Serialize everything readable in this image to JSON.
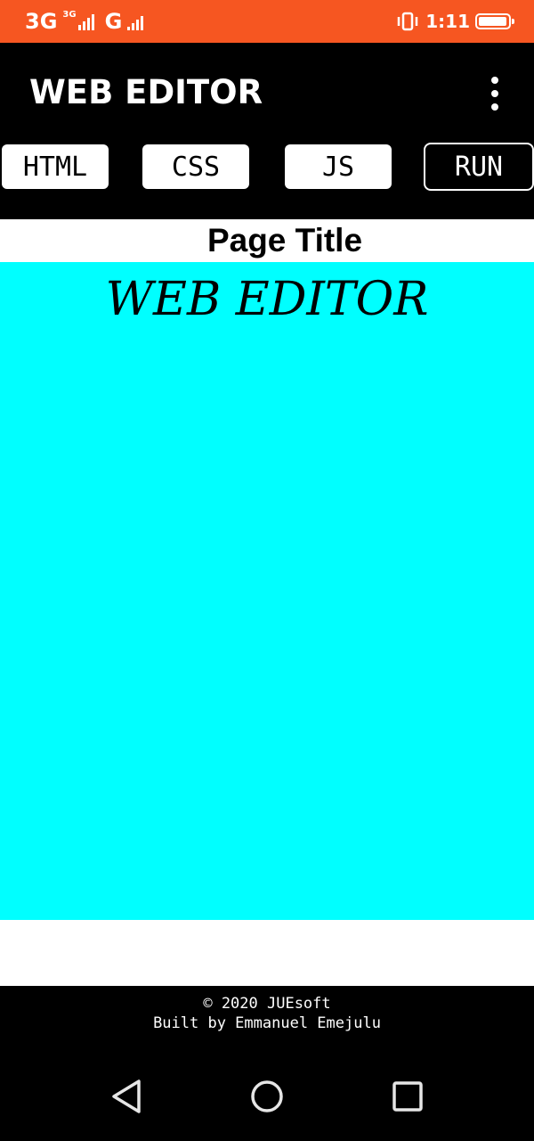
{
  "status_bar": {
    "network_1": "3G",
    "network_2": "3G",
    "network_3": "G",
    "time": "1:11",
    "battery_level": 0.85,
    "background_color": "#f65621"
  },
  "app_bar": {
    "title": "WEB EDITOR",
    "menu_icon": "more-vert-icon"
  },
  "tabs": {
    "html": "HTML",
    "css": "CSS",
    "js": "JS",
    "run": "RUN"
  },
  "preview": {
    "page_title": "Page Title",
    "heading": "WEB EDITOR",
    "background_color": "#00ffff"
  },
  "footer": {
    "copyright": "© 2020 JUEsoft",
    "credit": "Built by Emmanuel Emejulu"
  },
  "nav_bar": {
    "back_icon": "back-triangle-icon",
    "home_icon": "home-circle-icon",
    "recents_icon": "recents-square-icon"
  }
}
